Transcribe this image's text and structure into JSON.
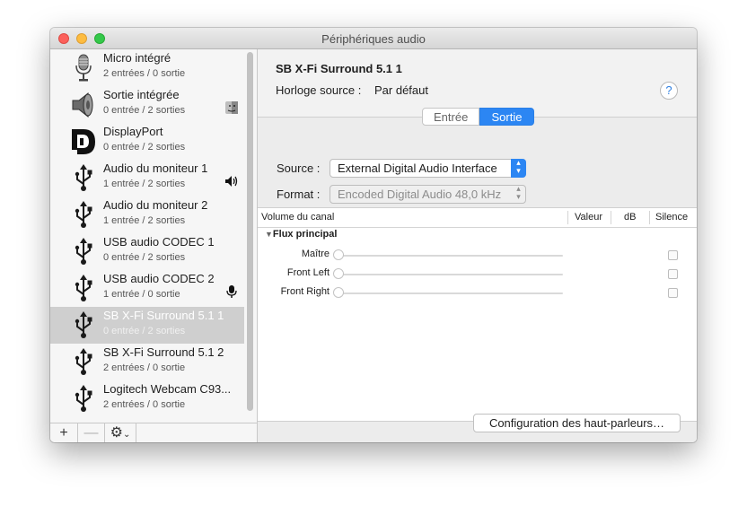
{
  "window": {
    "title": "Périphériques audio"
  },
  "devices": [
    {
      "name": "Micro intégré",
      "io": "2 entrées / 0 sortie",
      "icon": "microphone-icon"
    },
    {
      "name": "Sortie intégrée",
      "io": "0 entrée / 2 sorties",
      "icon": "speaker-icon",
      "badge": "finder-icon"
    },
    {
      "name": "DisplayPort",
      "io": "0 entrée / 2 sorties",
      "icon": "displayport-icon"
    },
    {
      "name": "Audio du moniteur 1",
      "io": "1 entrée / 2 sorties",
      "icon": "usb-icon",
      "badge": "speaker-badge-icon"
    },
    {
      "name": "Audio du moniteur 2",
      "io": "1 entrée / 2 sorties",
      "icon": "usb-icon"
    },
    {
      "name": "USB audio CODEC 1",
      "io": "0 entrée / 2 sorties",
      "icon": "usb-icon"
    },
    {
      "name": "USB audio CODEC 2",
      "io": "1 entrée / 0 sortie",
      "icon": "usb-icon",
      "badge": "microphone-badge-icon"
    },
    {
      "name": "SB X-Fi Surround 5.1 1",
      "io": "0 entrée / 2 sorties",
      "icon": "usb-icon",
      "selected": true
    },
    {
      "name": "SB X-Fi Surround 5.1 2",
      "io": "2 entrées / 0 sortie",
      "icon": "usb-icon"
    },
    {
      "name": "Logitech Webcam C93...",
      "io": "2 entrées / 0 sortie",
      "icon": "usb-icon"
    }
  ],
  "toolbar": {
    "add": "+",
    "remove": "—",
    "gear": "⚙",
    "gear_chevron": "⌄"
  },
  "detail": {
    "device_title": "SB X-Fi Surround 5.1 1",
    "clock_label": "Horloge source :",
    "clock_value": "Par défaut",
    "help": "?",
    "tabs": [
      "Entrée",
      "Sortie"
    ],
    "active_tab": "Sortie",
    "source_label": "Source :",
    "source_value": "External Digital Audio Interface",
    "format_label": "Format :",
    "format_value": "Encoded Digital Audio 48,0 kHz",
    "columns": [
      "Volume du canal",
      "Valeur",
      "dB",
      "Silence"
    ],
    "group": "Flux principal",
    "channels": [
      "Maître",
      "Front Left",
      "Front Right"
    ],
    "config_button": "Configuration des haut-parleurs…"
  },
  "colors": {
    "accent": "#2c86f3",
    "selected_row": "#cfcfcf"
  }
}
